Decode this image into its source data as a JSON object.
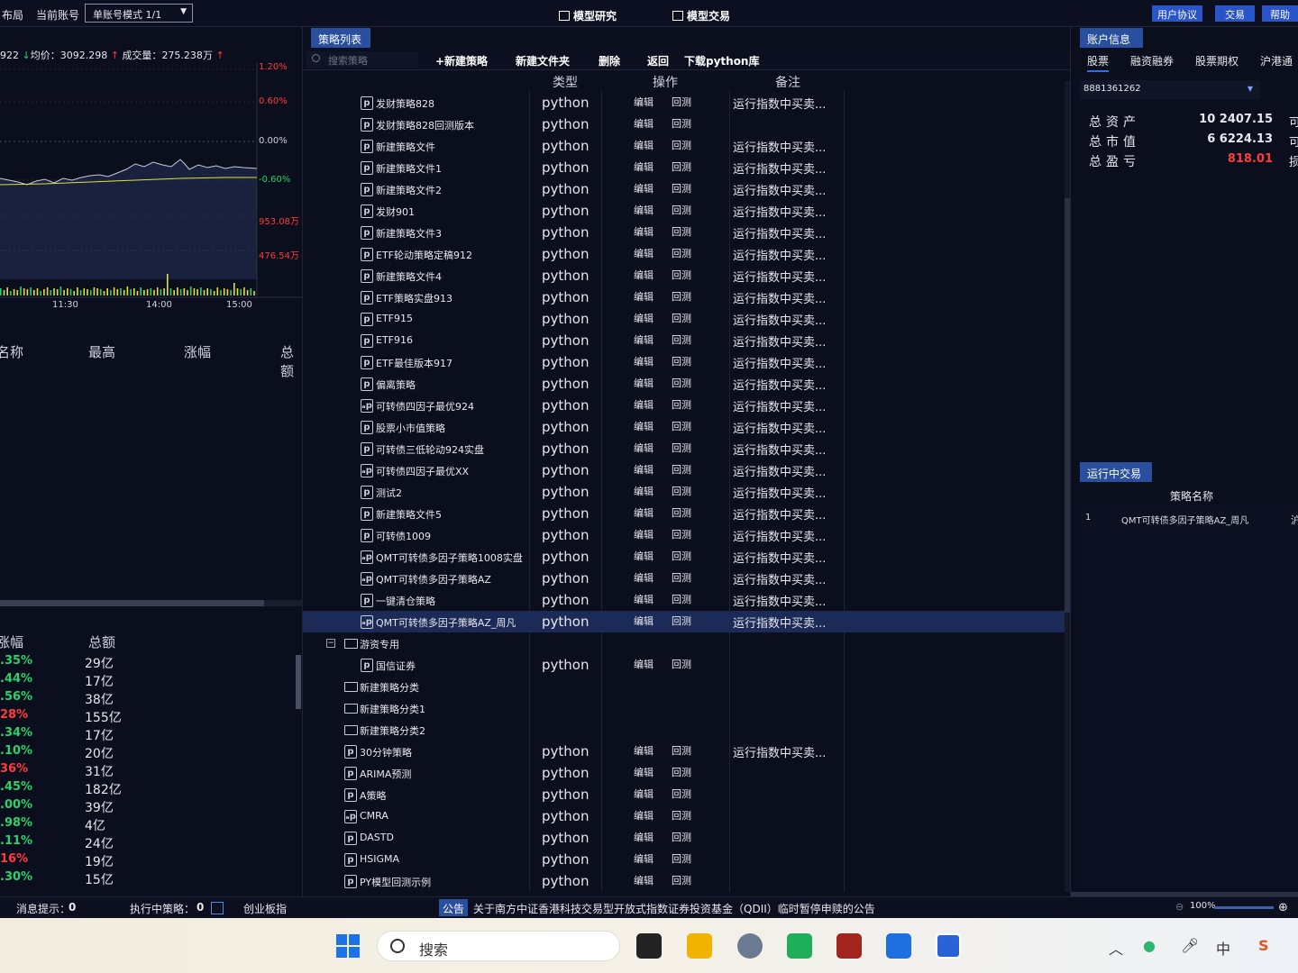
{
  "topbar": {
    "layout_label": "布局",
    "account_label": "当前账号",
    "account_mode": "单账号模式 1/1",
    "tab_research": "模型研究",
    "tab_trade": "模型交易",
    "btn_agreement": "用户协议",
    "btn_trade": "交易",
    "btn_help": "帮助"
  },
  "left": {
    "quote": {
      "prefix": "922",
      "avg_label": "均价：",
      "avg_value": "3092.298",
      "vol_label": "成交量：",
      "vol_value": "275.238万"
    },
    "pct_labels": [
      "1.20%",
      "0.60%",
      "0.00%",
      "-0.60%"
    ],
    "vol_labels": [
      "953.08万",
      "476.54万"
    ],
    "time_labels": [
      "11:30",
      "14:00",
      "15:00"
    ],
    "table1_headers": [
      "名称",
      "最高",
      "涨幅",
      "总额"
    ],
    "table2_headers": [
      "涨幅",
      "总额"
    ],
    "rows": [
      {
        "pct": ".35%",
        "amt": "29亿",
        "color": "green"
      },
      {
        "pct": ".44%",
        "amt": "17亿",
        "color": "green"
      },
      {
        "pct": ".56%",
        "amt": "38亿",
        "color": "green"
      },
      {
        "pct": "28%",
        "amt": "155亿",
        "color": "red"
      },
      {
        "pct": ".34%",
        "amt": "17亿",
        "color": "green"
      },
      {
        "pct": ".10%",
        "amt": "20亿",
        "color": "green"
      },
      {
        "pct": "36%",
        "amt": "31亿",
        "color": "red"
      },
      {
        "pct": ".45%",
        "amt": "182亿",
        "color": "green"
      },
      {
        "pct": ".00%",
        "amt": "39亿",
        "color": "green"
      },
      {
        "pct": ".98%",
        "amt": "4亿",
        "color": "green"
      },
      {
        "pct": ".11%",
        "amt": "24亿",
        "color": "green"
      },
      {
        "pct": "16%",
        "amt": "19亿",
        "color": "red"
      },
      {
        "pct": ".30%",
        "amt": "15亿",
        "color": "green"
      }
    ]
  },
  "mid": {
    "tab_label": "策略列表",
    "search_placeholder": "搜索策略",
    "toolbar": {
      "new_strategy": "+新建策略",
      "new_folder": "新建文件夹",
      "delete": "删除",
      "back": "返回",
      "download": "下载python库"
    },
    "col_type": "类型",
    "col_op": "操作",
    "col_note": "备注",
    "edit_label": "编辑",
    "backtest_label": "回测",
    "strategies": [
      {
        "name": "发财策略828",
        "type": "python",
        "note": "运行指数中买卖...",
        "kind": "p",
        "indent": 2
      },
      {
        "name": "发财策略828回测版本",
        "type": "python",
        "note": "",
        "kind": "p",
        "indent": 2
      },
      {
        "name": "新建策略文件",
        "type": "python",
        "note": "运行指数中买卖...",
        "kind": "p",
        "indent": 2
      },
      {
        "name": "新建策略文件1",
        "type": "python",
        "note": "运行指数中买卖...",
        "kind": "p",
        "indent": 2
      },
      {
        "name": "新建策略文件2",
        "type": "python",
        "note": "运行指数中买卖...",
        "kind": "p",
        "indent": 2
      },
      {
        "name": "发财901",
        "type": "python",
        "note": "运行指数中买卖...",
        "kind": "p",
        "indent": 2
      },
      {
        "name": "新建策略文件3",
        "type": "python",
        "note": "运行指数中买卖...",
        "kind": "p",
        "indent": 2
      },
      {
        "name": "ETF轮动策略定稿912",
        "type": "python",
        "note": "运行指数中买卖...",
        "kind": "p",
        "indent": 2
      },
      {
        "name": "新建策略文件4",
        "type": "python",
        "note": "运行指数中买卖...",
        "kind": "p",
        "indent": 2
      },
      {
        "name": "ETF策略实盘913",
        "type": "python",
        "note": "运行指数中买卖...",
        "kind": "p",
        "indent": 2
      },
      {
        "name": "ETF915",
        "type": "python",
        "note": "运行指数中买卖...",
        "kind": "p",
        "indent": 2
      },
      {
        "name": "ETF916",
        "type": "python",
        "note": "运行指数中买卖...",
        "kind": "p",
        "indent": 2
      },
      {
        "name": "ETF最佳版本917",
        "type": "python",
        "note": "运行指数中买卖...",
        "kind": "p",
        "indent": 2
      },
      {
        "name": "偏离策略",
        "type": "python",
        "note": "运行指数中买卖...",
        "kind": "p",
        "indent": 2
      },
      {
        "name": "可转债四因子最优924",
        "type": "python",
        "note": "运行指数中买卖...",
        "kind": "ap",
        "indent": 2
      },
      {
        "name": "股票小市值策略",
        "type": "python",
        "note": "运行指数中买卖...",
        "kind": "p",
        "indent": 2
      },
      {
        "name": "可转债三低轮动924实盘",
        "type": "python",
        "note": "运行指数中买卖...",
        "kind": "p",
        "indent": 2
      },
      {
        "name": "可转债四因子最优XX",
        "type": "python",
        "note": "运行指数中买卖...",
        "kind": "ap",
        "indent": 2
      },
      {
        "name": "测试2",
        "type": "python",
        "note": "运行指数中买卖...",
        "kind": "p",
        "indent": 2
      },
      {
        "name": "新建策略文件5",
        "type": "python",
        "note": "运行指数中买卖...",
        "kind": "p",
        "indent": 2
      },
      {
        "name": "可转债1009",
        "type": "python",
        "note": "运行指数中买卖...",
        "kind": "p",
        "indent": 2
      },
      {
        "name": "QMT可转债多因子策略1008实盘",
        "type": "python",
        "note": "运行指数中买卖...",
        "kind": "ap",
        "indent": 2
      },
      {
        "name": "QMT可转债多因子策略AZ",
        "type": "python",
        "note": "运行指数中买卖...",
        "kind": "ap",
        "indent": 2
      },
      {
        "name": "一键清仓策略",
        "type": "python",
        "note": "运行指数中买卖...",
        "kind": "p",
        "indent": 2
      },
      {
        "name": "QMT可转债多因子策略AZ_周凡",
        "type": "python",
        "note": "运行指数中买卖...",
        "kind": "ap",
        "indent": 2,
        "selected": true
      },
      {
        "name": "游资专用",
        "type": "",
        "note": "",
        "kind": "folder-open",
        "indent": 1
      },
      {
        "name": "国信证券",
        "type": "python",
        "note": "",
        "kind": "p",
        "indent": 2
      },
      {
        "name": "新建策略分类",
        "type": "",
        "note": "",
        "kind": "folder",
        "indent": 1
      },
      {
        "name": "新建策略分类1",
        "type": "",
        "note": "",
        "kind": "folder",
        "indent": 1
      },
      {
        "name": "新建策略分类2",
        "type": "",
        "note": "",
        "kind": "folder",
        "indent": 1
      },
      {
        "name": "30分钟策略",
        "type": "python",
        "note": "运行指数中买卖...",
        "kind": "p",
        "indent": 1
      },
      {
        "name": "ARIMA预测",
        "type": "python",
        "note": "",
        "kind": "p",
        "indent": 1
      },
      {
        "name": "A策略",
        "type": "python",
        "note": "",
        "kind": "p",
        "indent": 1
      },
      {
        "name": "CMRA",
        "type": "python",
        "note": "",
        "kind": "ap",
        "indent": 1
      },
      {
        "name": "DASTD",
        "type": "python",
        "note": "",
        "kind": "p",
        "indent": 1
      },
      {
        "name": "HSIGMA",
        "type": "python",
        "note": "",
        "kind": "p",
        "indent": 1
      },
      {
        "name": "PY模型回测示例",
        "type": "python",
        "note": "",
        "kind": "p",
        "indent": 1
      }
    ]
  },
  "right": {
    "tab_account": "账户信息",
    "subtabs": [
      "股票",
      "融资融券",
      "股票期权",
      "沪港通"
    ],
    "account_no": "8881361262",
    "metrics": [
      {
        "label": "总资产",
        "value": "10 2407.15",
        "color": "#e6e8ee",
        "trail": "可"
      },
      {
        "label": "总市值",
        "value": "6 6224.13",
        "color": "#e6e8ee",
        "trail": "可"
      },
      {
        "label": "总盈亏",
        "value": "818.01",
        "color": "#ff3b3b",
        "trail": "损"
      }
    ],
    "tab_running": "运行中交易",
    "running_header": "策略名称",
    "running_rows": [
      {
        "idx": "1",
        "name": "QMT可转债多因子策略AZ_周凡",
        "trail": "沪"
      }
    ]
  },
  "status": {
    "msg_label": "消息提示：",
    "msg_count": "0",
    "exec_label": "执行中策略：",
    "exec_count": "0",
    "index_label": "创业板指",
    "notice_tag": "公告",
    "notice_text": "关于南方中证香港科技交易型开放式指数证券投资基金（QDII）临时暂停申赎的公告",
    "zoom": "100%"
  },
  "taskbar": {
    "search_label": "搜索",
    "ime_label": "中"
  }
}
